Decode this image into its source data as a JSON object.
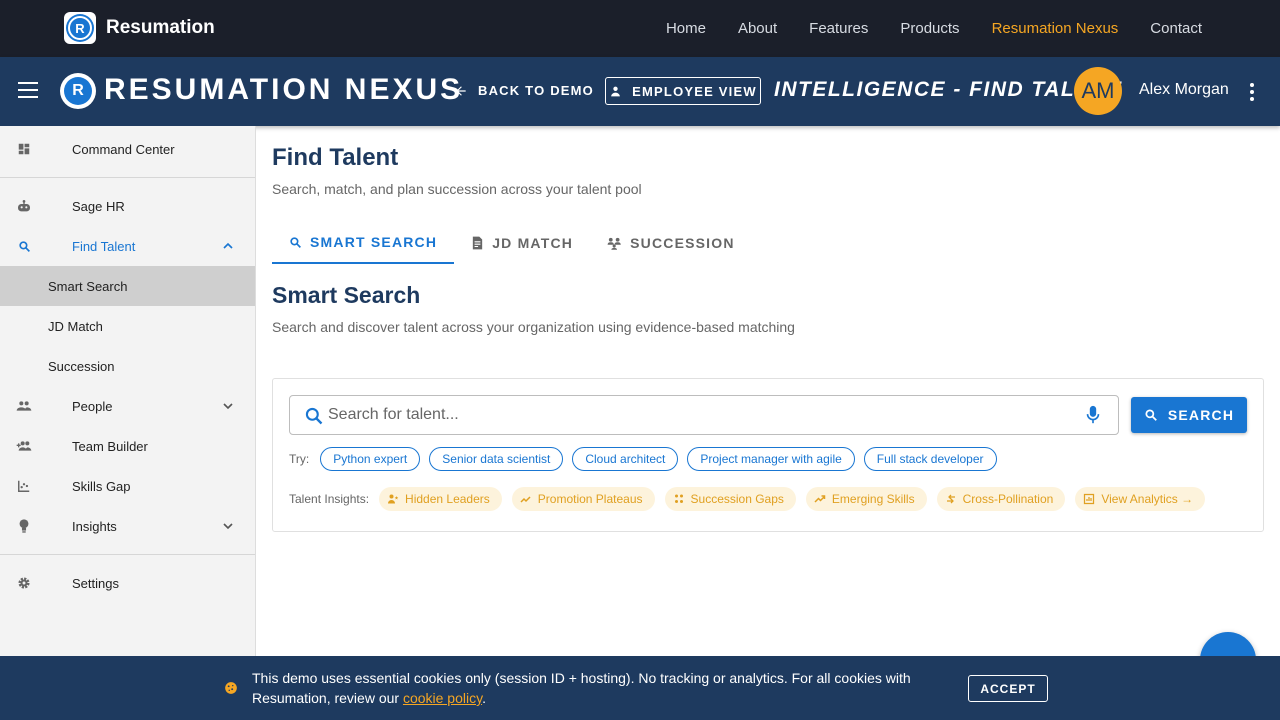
{
  "site": {
    "brand_letter": "R",
    "brand": "Resumation",
    "links": [
      {
        "label": "Home"
      },
      {
        "label": "About"
      },
      {
        "label": "Features"
      },
      {
        "label": "Products"
      },
      {
        "label": "Resumation Nexus",
        "active": true
      },
      {
        "label": "Contact"
      }
    ],
    "accent_color": "#f5a623"
  },
  "appbar": {
    "logo_letter": "R",
    "title": "RESUMATION NEXUS",
    "back_label": "BACK TO DEMO",
    "employee_view_label": "EMPLOYEE VIEW",
    "section_title": "INTELLIGENCE - FIND TALENT",
    "avatar_initials": "AM",
    "user_name": "Alex Morgan",
    "background_color": "#1e3a5f"
  },
  "sidebar": {
    "items": [
      {
        "label": "Command Center",
        "icon": "dashboard-icon"
      },
      {
        "label": "Sage HR",
        "icon": "robot-icon"
      },
      {
        "label": "Find Talent",
        "icon": "search-icon",
        "active": true,
        "expanded": true
      },
      {
        "label": "Smart Search",
        "sub": true,
        "selected": true
      },
      {
        "label": "JD Match",
        "sub": true
      },
      {
        "label": "Succession",
        "sub": true
      },
      {
        "label": "People",
        "icon": "people-icon",
        "expandable": true
      },
      {
        "label": "Team Builder",
        "icon": "group-add-icon"
      },
      {
        "label": "Skills Gap",
        "icon": "chart-icon"
      },
      {
        "label": "Insights",
        "icon": "lightbulb-icon",
        "expandable": true
      },
      {
        "label": "Settings",
        "icon": "gear-icon"
      }
    ]
  },
  "main": {
    "title": "Find Talent",
    "subtitle": "Search, match, and plan succession across your talent pool",
    "tabs": [
      {
        "label": "SMART SEARCH",
        "icon": "search-icon",
        "active": true
      },
      {
        "label": "JD MATCH",
        "icon": "document-icon"
      },
      {
        "label": "SUCCESSION",
        "icon": "hierarchy-icon"
      }
    ],
    "section_title": "Smart Search",
    "section_subtitle": "Search and discover talent across your organization using evidence-based matching",
    "search": {
      "placeholder": "Search for talent...",
      "value": "",
      "button_label": "SEARCH"
    },
    "try_label": "Try:",
    "suggestions": [
      "Python expert",
      "Senior data scientist",
      "Cloud architect",
      "Project manager with agile",
      "Full stack developer"
    ],
    "insights_label": "Talent Insights:",
    "insights": [
      {
        "label": "Hidden Leaders",
        "icon": "person-star-icon"
      },
      {
        "label": "Promotion Plateaus",
        "icon": "trend-flat-icon"
      },
      {
        "label": "Succession Gaps",
        "icon": "group-icon"
      },
      {
        "label": "Emerging Skills",
        "icon": "trending-up-icon"
      },
      {
        "label": "Cross-Pollination",
        "icon": "swap-icon"
      },
      {
        "label": "View Analytics →",
        "icon": "analytics-icon"
      }
    ],
    "primary_color": "#1976d2"
  },
  "cookie": {
    "text_before": "This demo uses essential cookies only (session ID + hosting). No tracking or analytics. For all cookies with Resumation, review our ",
    "link_label": "cookie policy",
    "text_after": ".",
    "accept_label": "ACCEPT"
  }
}
